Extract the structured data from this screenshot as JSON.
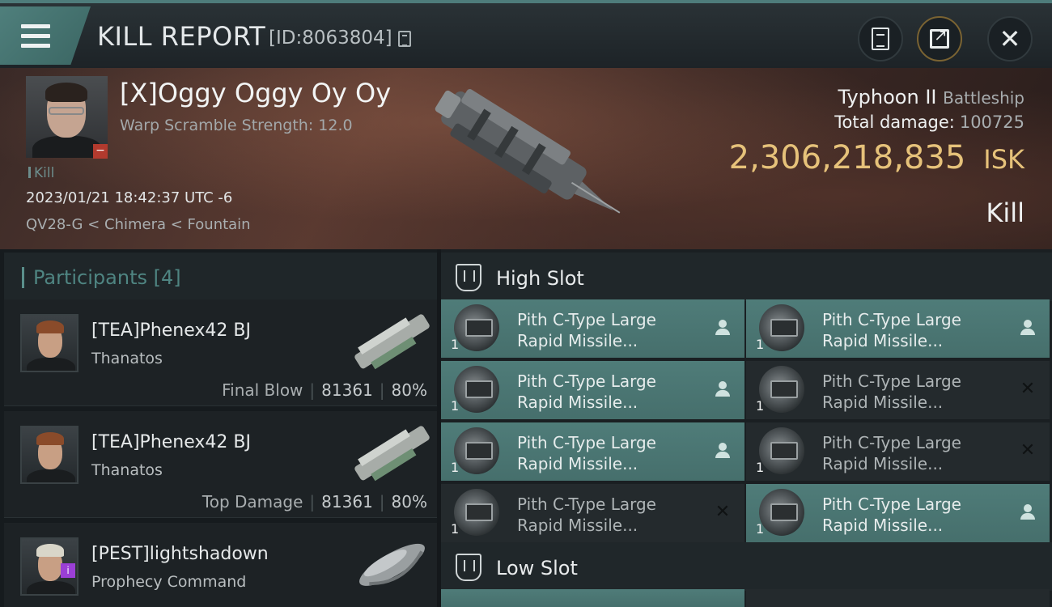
{
  "header": {
    "title": "KILL REPORT",
    "report_id": "[ID:8063804]"
  },
  "victim": {
    "name": "[X]Oggy Oggy Oy Oy",
    "warp_scramble": "Warp Scramble Strength: 12.0",
    "kill_tag": "Kill",
    "timestamp": "2023/01/21 18:42:37 UTC -6",
    "location": "QV28-G < Chimera < Fountain"
  },
  "ship": {
    "name": "Typhoon II",
    "class": "Battleship",
    "total_damage_label": "Total damage:",
    "total_damage": "100725",
    "isk_value": "2,306,218,835",
    "isk_unit": "ISK",
    "result": "Kill"
  },
  "participants": {
    "header": "Participants [4]",
    "rows": [
      {
        "name": "[TEA]Phenex42 BJ",
        "ship": "Thanatos",
        "label": "Final Blow",
        "damage": "81361",
        "percent": "80%"
      },
      {
        "name": "[TEA]Phenex42 BJ",
        "ship": "Thanatos",
        "label": "Top Damage",
        "damage": "81361",
        "percent": "80%"
      },
      {
        "name": "[PEST]lightshadown",
        "ship": "Prophecy Command",
        "label": "",
        "damage": "",
        "percent": ""
      }
    ]
  },
  "slots": {
    "high_title": "High Slot",
    "low_title": "Low Slot",
    "high_modules": [
      {
        "line1": "Pith C-Type Large",
        "line2": "Rapid Missile...",
        "qty": "1",
        "state": "on"
      },
      {
        "line1": "Pith C-Type Large",
        "line2": "Rapid Missile...",
        "qty": "1",
        "state": "on"
      },
      {
        "line1": "Pith C-Type Large",
        "line2": "Rapid Missile...",
        "qty": "1",
        "state": "on"
      },
      {
        "line1": "Pith C-Type Large",
        "line2": "Rapid Missile...",
        "qty": "1",
        "state": "off"
      },
      {
        "line1": "Pith C-Type Large",
        "line2": "Rapid Missile...",
        "qty": "1",
        "state": "on"
      },
      {
        "line1": "Pith C-Type Large",
        "line2": "Rapid Missile...",
        "qty": "1",
        "state": "off"
      },
      {
        "line1": "Pith C-Type Large",
        "line2": "Rapid Missile...",
        "qty": "1",
        "state": "off"
      },
      {
        "line1": "Pith C-Type Large",
        "line2": "Rapid Missile...",
        "qty": "1",
        "state": "on"
      }
    ]
  },
  "colors": {
    "accent": "#4f7f7c",
    "isk_gold": "#e6c27a",
    "module_active": "#4f7c79",
    "module_inactive": "#242a2d"
  },
  "icons": {
    "menu": "hamburger-icon",
    "copy": "copy-icon",
    "clipboard": "clipboard-icon",
    "share": "share-icon",
    "close": "close-icon",
    "slot": "high-slot-icon",
    "pilot": "user-icon",
    "destroyed": "x-icon"
  }
}
